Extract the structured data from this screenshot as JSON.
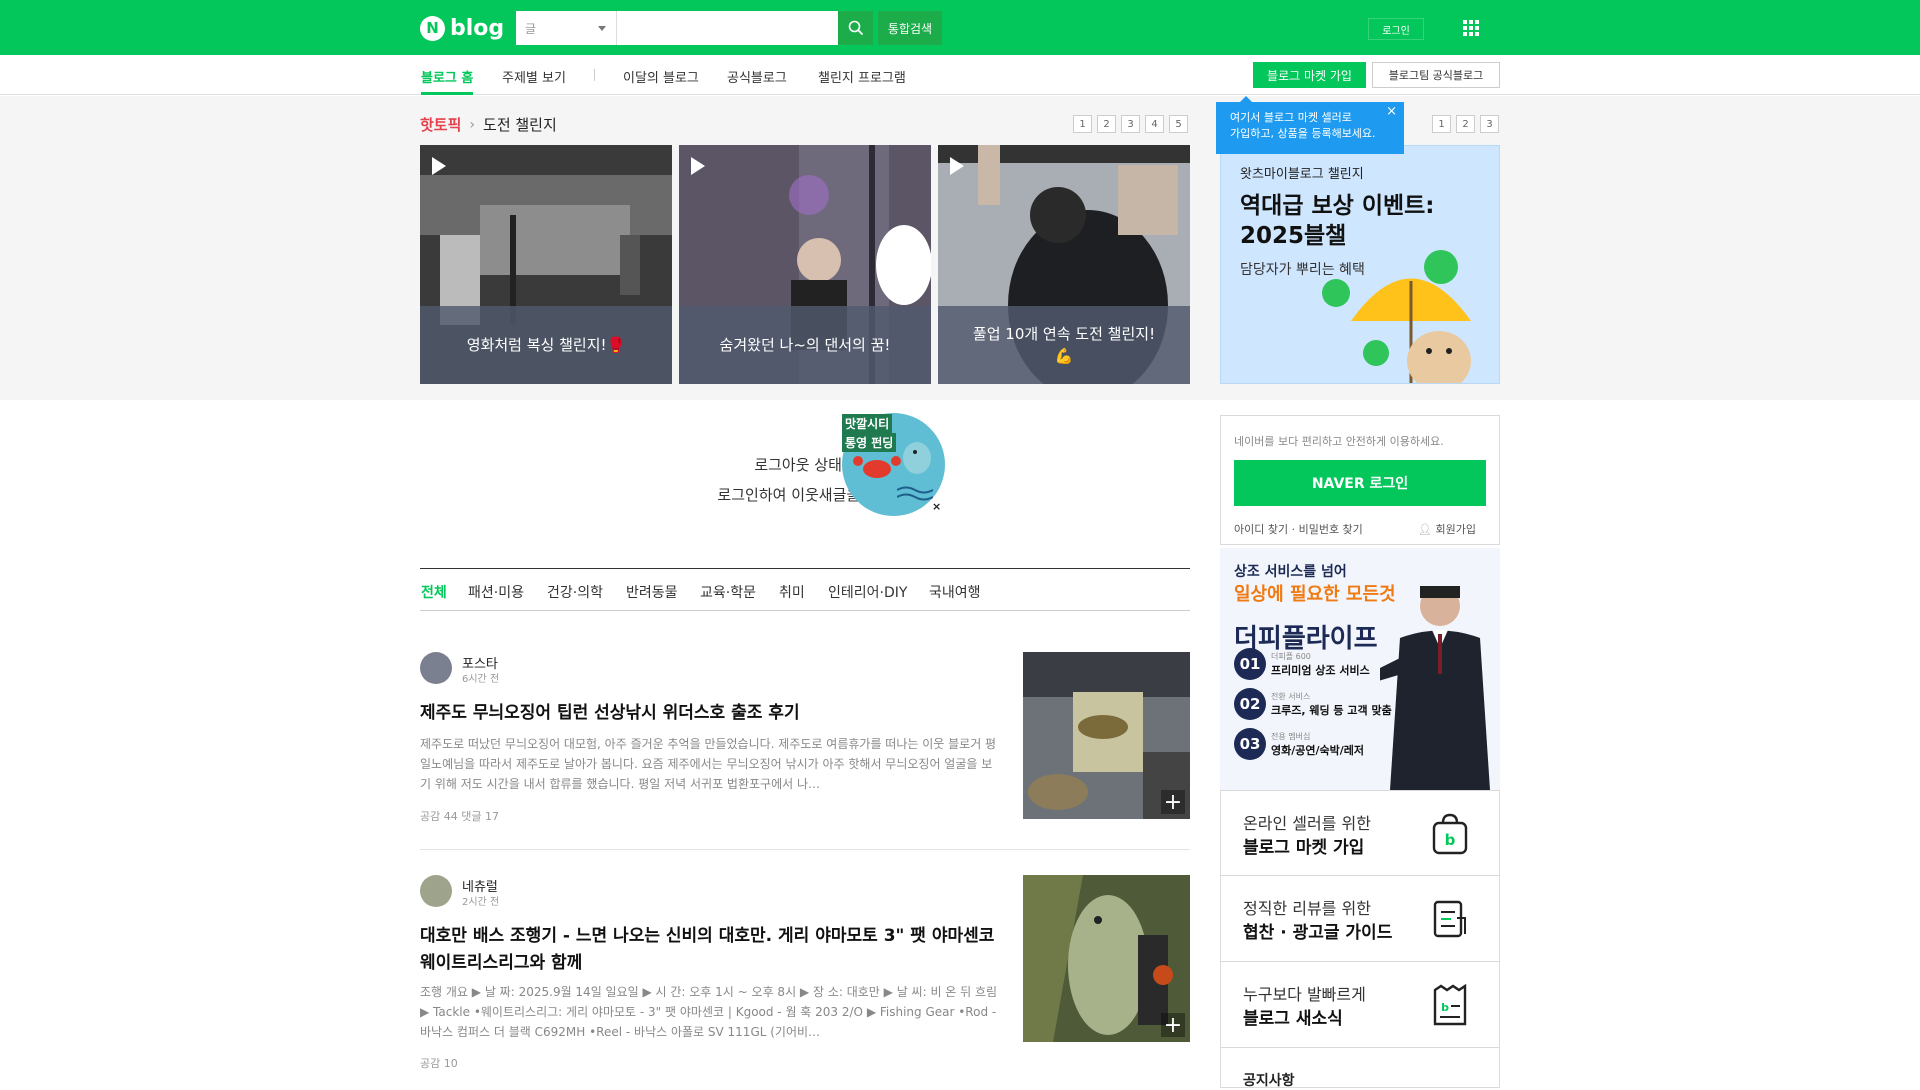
{
  "header": {
    "logo_text": "blog",
    "logo_n": "N",
    "search_scope": "글",
    "search_placeholder": "",
    "search_all_label": "통합검색",
    "login_label": "로그인"
  },
  "subnav": {
    "tabs": [
      "블로그 홈",
      "주제별 보기",
      "이달의 블로그",
      "공식블로그",
      "챌린지 프로그램"
    ],
    "market_join_label": "블로그 마켓 가입",
    "team_blog_label": "블로그팀 공식블로그"
  },
  "hot_topic": {
    "label": "핫토픽",
    "title": "도전 챌린지",
    "pages": [
      "1",
      "2",
      "3",
      "4",
      "5"
    ],
    "cards": [
      {
        "caption": "영화처럼 복싱 챌린지!🥊"
      },
      {
        "caption": "숨겨왔던 나~의 댄서의 꿈!"
      },
      {
        "caption": "풀업 10개 연속 도전 챌린지!💪"
      }
    ]
  },
  "tooltip": {
    "text_line1": "여기서 블로그 마켓 셀러로",
    "text_line2": "가입하고, 상품을 등록해보세요.",
    "close": "×"
  },
  "challenge_banner": {
    "pages": [
      "1",
      "2",
      "3"
    ],
    "subtitle": "왓츠마이블로그 챌린지",
    "title_line1": "역대급 보상 이벤트:",
    "title_line2": "2025블챌",
    "desc": "담당자가 뿌리는 혜택"
  },
  "logout_notice": {
    "line1": "로그아웃 상태입",
    "line2": "로그인하여 이웃새글을 확인",
    "ad_line1": "맛깔시티",
    "ad_line2": "통영 펀딩",
    "ad_close": "×"
  },
  "categories": [
    "전체",
    "패션·미용",
    "건강·의학",
    "반려동물",
    "교육·학문",
    "취미",
    "인테리어·DIY",
    "국내여행"
  ],
  "posts": [
    {
      "author": "포스타",
      "time": "6시간 전",
      "title": "제주도 무늬오징어 팁런 선상낚시 위더스호 출조 후기",
      "excerpt": "제주도로 떠났던 무늬오징어 대모험, 아주 즐거운 추억을 만들었습니다. 제주도로 여름휴가를 떠나는 이웃 블로거 평일노예님을 따라서 제주도로 날아가 봅니다. 요즘 제주에서는 무늬오징어 낚시가 아주 핫해서 무늬오징어 얼굴을 보기 위해 저도 시간을 내서 합류를 했습니다. 평일 저녁 서귀포 법환포구에서 나…",
      "meta": "공감 44   댓글 17"
    },
    {
      "author": "네츄럴",
      "time": "2시간 전",
      "title": "대호만 배스 조행기 - 느면 나오는 신비의 대호만. 게리 야마모토 3\" 팻 야마센코 웨이트리스리그와 함께",
      "excerpt": "조행 개요 ▶ 날 짜: 2025.9월 14일 일요일 ▶ 시 간: 오후 1시 ~ 오후 8시 ▶ 장 소: 대호만 ▶ 날 씨: 비 온 뒤 흐림 ▶ Tackle •웨이트리스리그: 게리 야마모토 - 3\" 팻 야마센코 | Kgood - 웜 훅 203 2/O ▶ Fishing Gear •Rod - 바낙스 컴퍼스 더 블랙 C692MH •Reel - 바낙스 아폴로 SV 111GL (기어비…",
      "meta": "공감 10"
    }
  ],
  "login_box": {
    "message": "네이버를 보다 편리하고 안전하게 이용하세요.",
    "button": "NAVER 로그인",
    "find": "아이디 찾기 · 비밀번호 찾기",
    "join": "회원가입"
  },
  "ad_banner": {
    "line1": "상조 서비스를 넘어",
    "line2": "일상에 필요한 모든것",
    "brand": "더피플라이프",
    "items": [
      {
        "num": "01",
        "small": "더피플 600",
        "big": "프리미엄 상조 서비스"
      },
      {
        "num": "02",
        "small": "전환 서비스",
        "big": "크루즈, 웨딩 등 고객 맞춤"
      },
      {
        "num": "03",
        "small": "전용 멤버십",
        "big": "영화/공연/숙박/레저"
      }
    ]
  },
  "links": [
    {
      "line1": "온라인 셀러를 위한",
      "line2": "블로그 마켓 가입",
      "icon": "shopping-bag-icon"
    },
    {
      "line1": "정직한 리뷰를 위한",
      "line2": "협찬 · 광고글 가이드",
      "icon": "document-guide-icon"
    },
    {
      "line1": "누구보다 발빠르게",
      "line2": "블로그 새소식",
      "icon": "news-icon"
    }
  ],
  "notice_title": "공지사항",
  "colors": {
    "brand_green": "#03c75a",
    "hot_red": "#e5404b",
    "tooltip_blue": "#1e9bf0"
  }
}
